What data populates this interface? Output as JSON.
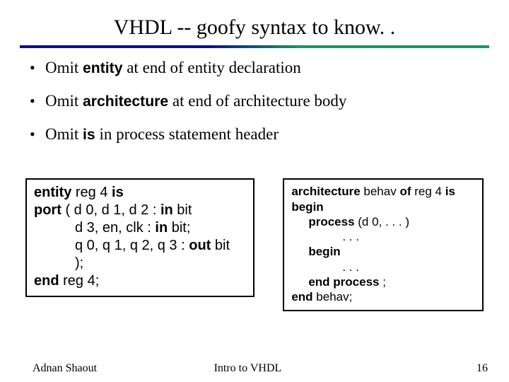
{
  "title": "VHDL -- goofy syntax to know. .",
  "bullets": [
    {
      "pre": "Omit ",
      "kw": "entity",
      "post": " at end of entity declaration"
    },
    {
      "pre": "Omit ",
      "kw": "architecture",
      "post": " at end of architecture body"
    },
    {
      "pre": "Omit ",
      "kw": "is",
      "post": " in process statement header"
    }
  ],
  "code_left": {
    "l1a": "entity",
    "l1b": " reg 4 ",
    "l1c": "is",
    "l2a": "port",
    "l2b": " ( d 0, d 1, d 2  : ",
    "l2c": "in",
    "l2d": " bit",
    "l3a": "d 3, en, clk : ",
    "l3b": "in",
    "l3c": " bit;",
    "l4a": "q 0, q 1, q 2, q 3 : ",
    "l4b": "out",
    "l4c": " bit",
    "l5": ");",
    "l6a": "end",
    "l6b": " reg 4;"
  },
  "code_right": {
    "l1a": "architecture",
    "l1b": " behav ",
    "l1c": "of",
    "l1d": " reg 4 ",
    "l1e": "is",
    "l2": "begin",
    "l3a": "process",
    "l3b": " (d 0, . . . )",
    "l4": ". . .",
    "l5": "begin",
    "l6": ". . .",
    "l7a": "end process",
    "l7b": " ;",
    "l8a": "end",
    "l8b": " behav;"
  },
  "footer": {
    "left": "Adnan Shaout",
    "center": "Intro to VHDL",
    "right": "16"
  }
}
